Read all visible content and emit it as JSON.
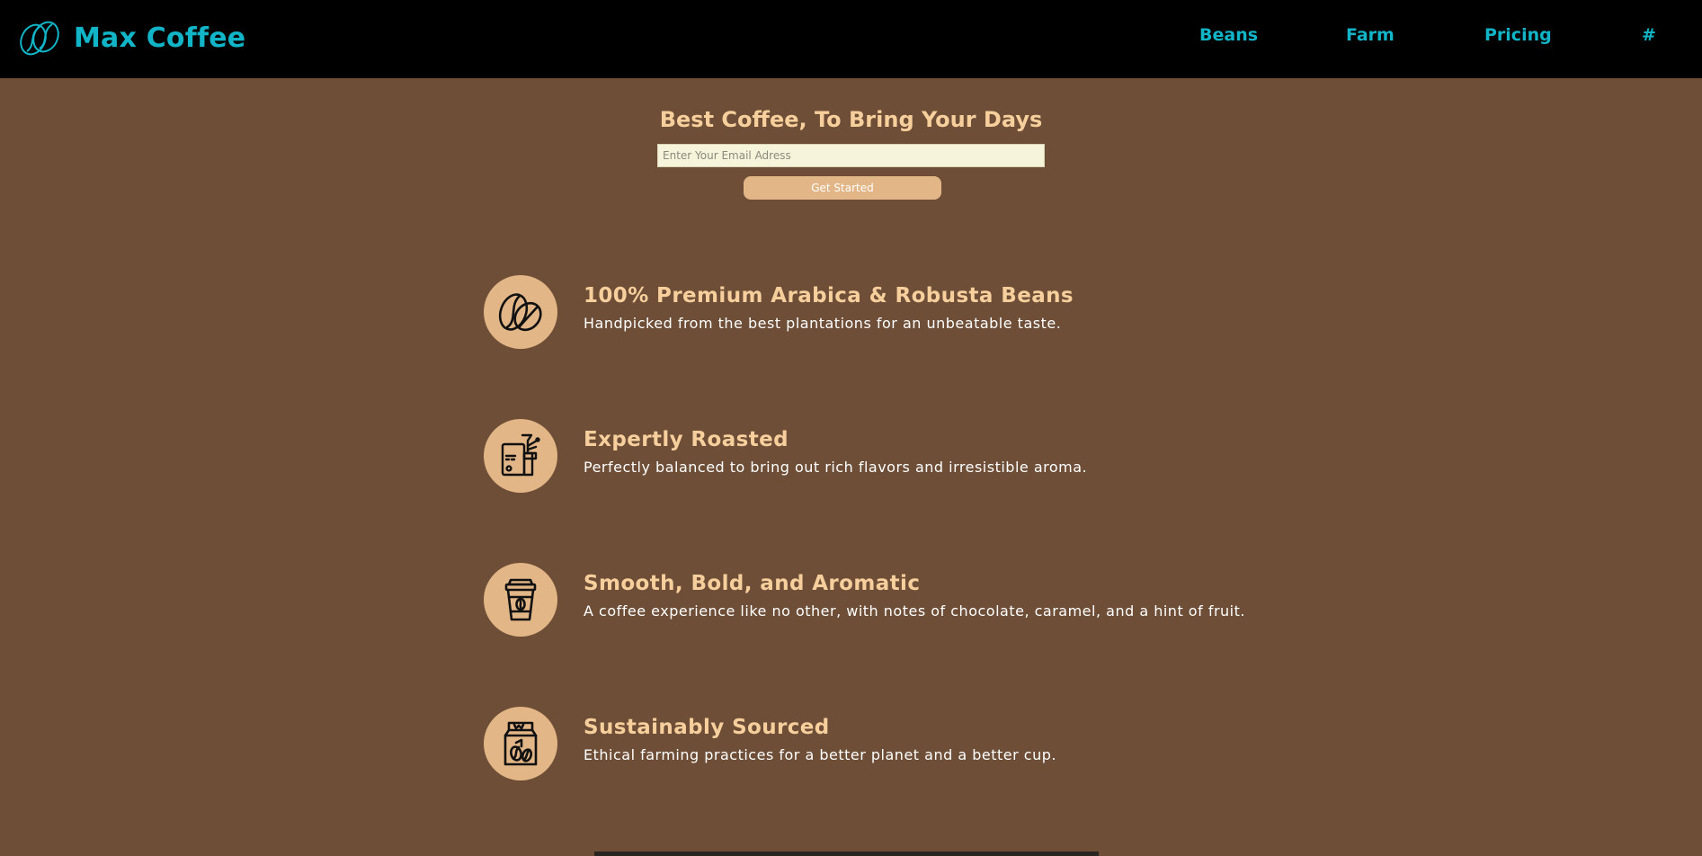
{
  "brand": {
    "name": "Max Coffee",
    "logo_icon": "coffee-beans-outline-icon"
  },
  "nav": {
    "links": [
      {
        "label": "Beans"
      },
      {
        "label": "Farm"
      },
      {
        "label": "Pricing"
      },
      {
        "label": "#"
      }
    ]
  },
  "hero": {
    "title": "Best Coffee, To Bring Your Days",
    "email_placeholder": "Enter Your Email Adress",
    "email_value": "",
    "cta_label": "Get Started"
  },
  "features": [
    {
      "icon": "coffee-bean-icon",
      "title": "100% Premium Arabica & Robusta Beans",
      "desc": "Handpicked from the best plantations for an unbeatable taste."
    },
    {
      "icon": "roasting-machine-icon",
      "title": "Expertly Roasted",
      "desc": "Perfectly balanced to bring out rich flavors and irresistible aroma."
    },
    {
      "icon": "coffee-cup-icon",
      "title": "Smooth, Bold, and Aromatic",
      "desc": "A coffee experience like no other, with notes of chocolate, caramel, and a hint of fruit."
    },
    {
      "icon": "coffee-bag-icon",
      "title": "Sustainably Sourced",
      "desc": "Ethical farming practices for a better planet and a better cup."
    }
  ],
  "colors": {
    "background": "#6e4e37",
    "navbar": "#000000",
    "accent_cyan": "#12b5c7",
    "heading_tan": "#f6cf9c",
    "icon_circle": "#e2b686",
    "button": "#e2b686",
    "input_bg": "#f6f4da"
  }
}
